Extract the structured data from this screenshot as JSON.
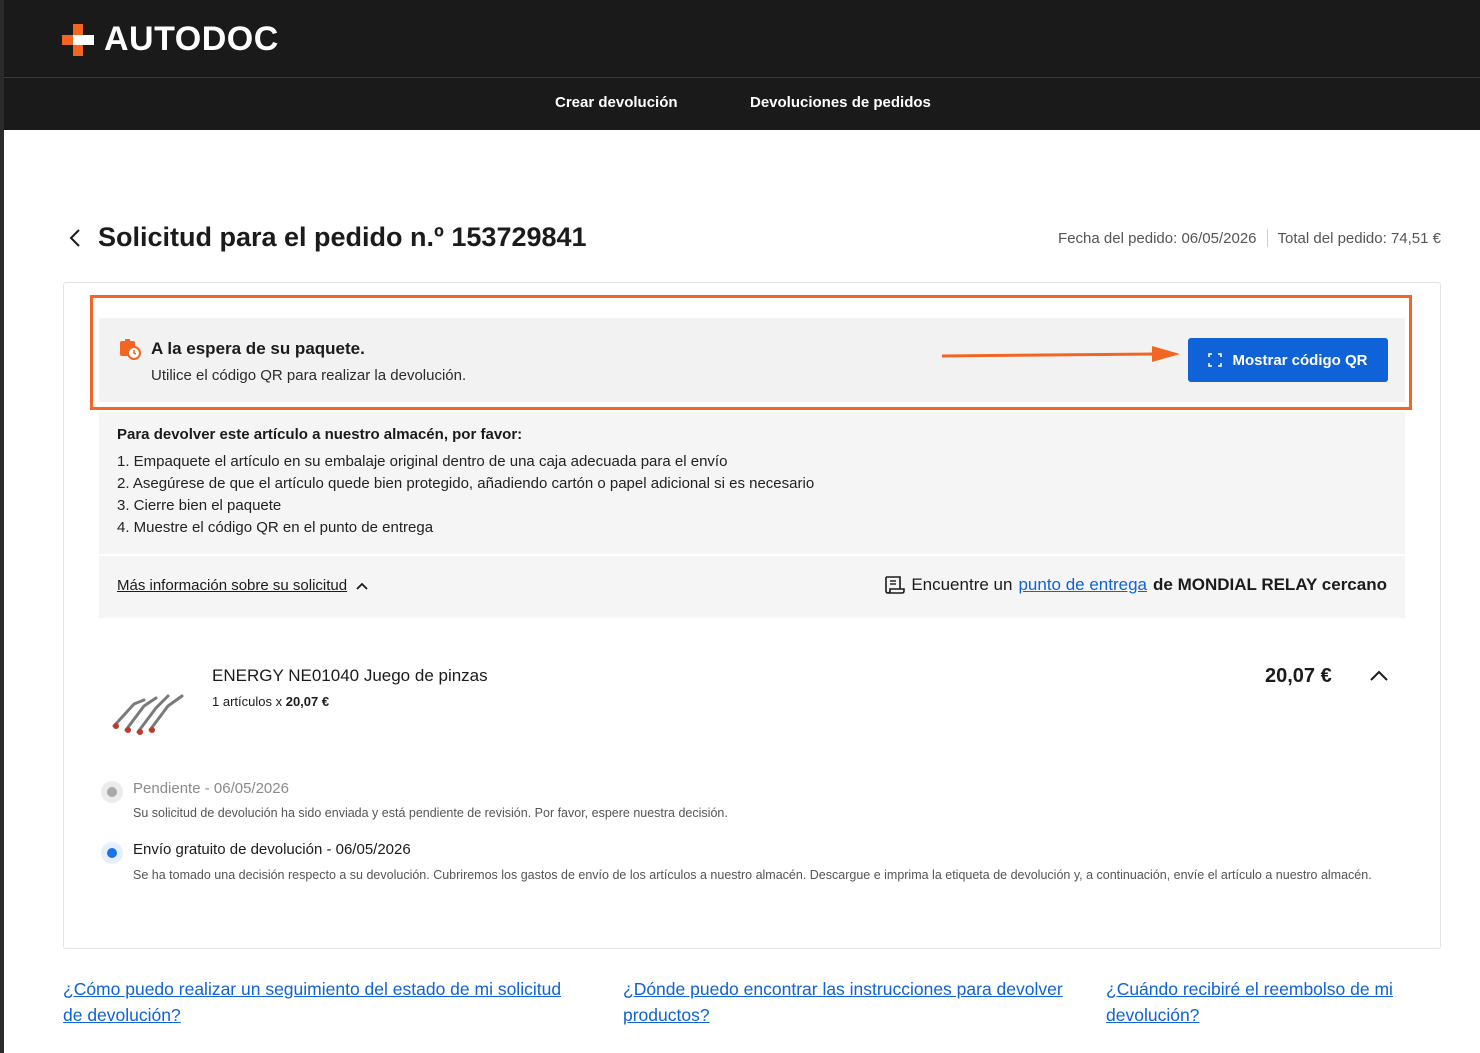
{
  "brand": {
    "name": "AUTODOC",
    "accent_color": "#f26522",
    "primary_color": "#0f62d8"
  },
  "nav": {
    "items": [
      {
        "label": "Crear devolución"
      },
      {
        "label": "Devoluciones de pedidos"
      }
    ]
  },
  "header": {
    "title": "Solicitud para el pedido n.º 153729841",
    "order_date": "Fecha del pedido: 06/05/2026",
    "order_total": "Total del pedido: 74,51 €"
  },
  "status": {
    "icon": "package-clock-icon",
    "title": "A la espera de su paquete.",
    "subtitle": "Utilice el código QR para realizar la devolución.",
    "button_label": "Mostrar código QR"
  },
  "instructions": {
    "title": "Para devolver este artículo a nuestro almacén, por favor:",
    "steps": [
      "1. Empaquete el artículo en su embalaje original dentro de una caja adecuada para el envío",
      "2. Asegúrese de que el artículo quede bien protegido, añadiendo cartón o papel adicional si es necesario",
      "3. Cierre bien el paquete",
      "4. Muestre el código QR en el punto de entrega"
    ]
  },
  "info": {
    "more_info_label": "Más información sobre su solicitud",
    "dropoff_prefix": "Encuentre un",
    "dropoff_link": "punto de entrega",
    "dropoff_suffix": "de MONDIAL RELAY cercano"
  },
  "product": {
    "name": "ENERGY NE01040 Juego de pinzas",
    "qty_prefix": "1 artículos x",
    "unit_price": "20,07 €",
    "price": "20,07 €"
  },
  "timeline": [
    {
      "title": "Pendiente - 06/05/2026",
      "description": "Su solicitud de devolución ha sido enviada y está pendiente de revisión. Por favor, espere nuestra decisión."
    },
    {
      "title": "Envío gratuito de devolución - 06/05/2026",
      "description": "Se ha tomado una decisión respecto a su devolución. Cubriremos los gastos de envío de los artículos a nuestro almacén. Descargue e imprima la etiqueta de devolución y, a continuación, envíe el artículo a nuestro almacén."
    }
  ],
  "faq": [
    {
      "line1": "¿Cómo puedo realizar un seguimiento del estado de mi solicitud",
      "line2": "de devolución?"
    },
    {
      "line1": "¿Dónde puedo encontrar las instrucciones para devolver",
      "line2": "productos?"
    },
    {
      "line1": "¿Cuándo recibiré el reembolso de mi",
      "line2": "devolución?"
    }
  ]
}
